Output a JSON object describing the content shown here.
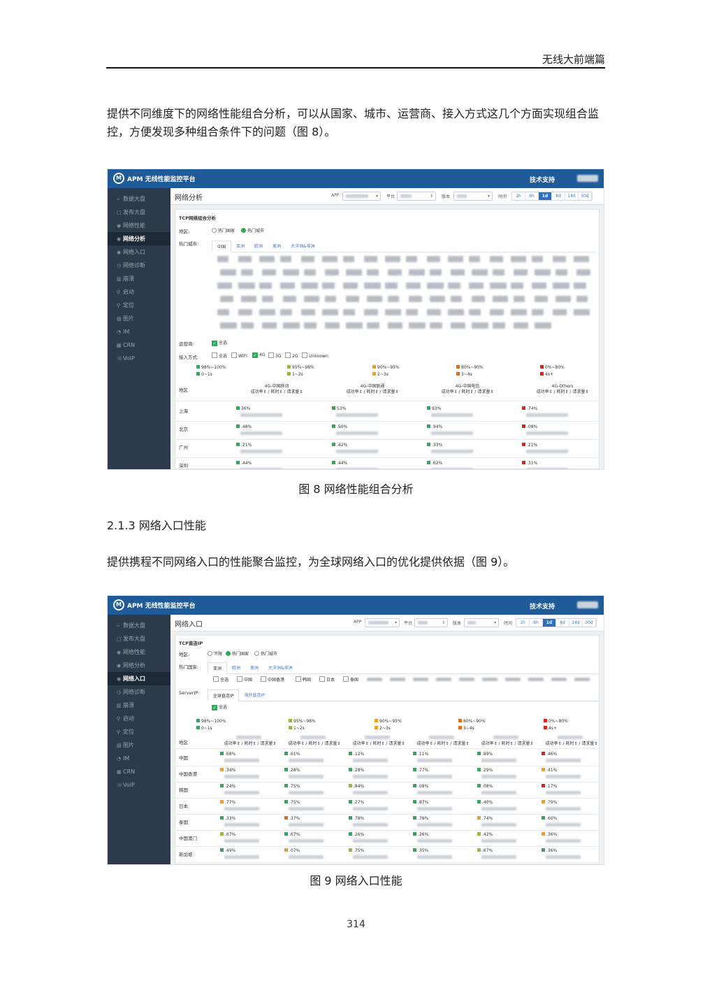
{
  "header": {
    "title": "无线大前端篇"
  },
  "paragraph1": "提供不同维度下的网络性能组合分析，可以从国家、城市、运营商、接入方式这几个方面实现组合监控，方便发现多种组合条件下的问题（图 8）。",
  "figure8_caption": "图 8 网络性能组合分析",
  "section_heading": "2.1.3 网络入口性能",
  "paragraph2": "提供携程不同网络入口的性能聚合监控，为全球网络入口的优化提供依据（图 9）。",
  "figure9_caption": "图 9 网络入口性能",
  "page_number": "314",
  "app": {
    "brand": "APM 无线性能监控平台",
    "support": "技术支持",
    "logo": "M",
    "toolbar": {
      "app_label": "APP",
      "platform_label": "平台",
      "version_label": "版本",
      "time_label": "时间",
      "ranges": [
        "1h",
        "6h",
        "1d",
        "8d",
        "14d",
        "30d"
      ],
      "active_range": "1d"
    },
    "sidebar": [
      {
        "icon": "chart-line-icon",
        "label": "数据大盘"
      },
      {
        "icon": "square-icon",
        "label": "发布大盘"
      },
      {
        "icon": "wifi-icon",
        "label": "网络性能"
      },
      {
        "icon": "wifi-icon",
        "label": "网络分析"
      },
      {
        "icon": "wifi-icon",
        "label": "网络入口"
      },
      {
        "icon": "clock-icon",
        "label": "网络诊断"
      },
      {
        "icon": "bars-icon",
        "label": "崩溃"
      },
      {
        "icon": "pin-icon",
        "label": "启动"
      },
      {
        "icon": "pin-icon",
        "label": "定位"
      },
      {
        "icon": "image-icon",
        "label": "图片"
      },
      {
        "icon": "chat-icon",
        "label": "IM"
      },
      {
        "icon": "grid-icon",
        "label": "CRN"
      },
      {
        "icon": "phone-icon",
        "label": "VoIP"
      }
    ],
    "colors": {
      "topbar": "#1f5b98",
      "sidebar": "#2c3a4b",
      "green": "#31a85a",
      "olive": "#a3b52c",
      "orange": "#e8a12a",
      "darkorange": "#e0701f",
      "red": "#d9261c"
    }
  },
  "fig8": {
    "active_menu": "网络分析",
    "page_title": "网络分析",
    "panel_title": "TCP网络组合分析",
    "region_label": "地区:",
    "region_options": [
      "热门国家",
      "热门城市"
    ],
    "hot_city_label": "热门城市:",
    "city_tabs": [
      "中国",
      "亚洲",
      "欧洲",
      "美洲",
      "大洋洲&非洲"
    ],
    "carrier_label": "运营商:",
    "carrier_all": "全选",
    "access_label": "接入方式:",
    "access_options": [
      "全选",
      "WIFI",
      "4G",
      "3G",
      "2G",
      "Unknown"
    ],
    "legend_top": [
      "98%~100%",
      "95%~98%",
      "90%~95%",
      "80%~90%",
      "0%~80%"
    ],
    "legend_bottom": [
      "0~1s",
      "1~2s",
      "2~3s",
      "3~4s",
      "4s+"
    ],
    "col_region": "地区",
    "col_sub": "成功率⇕ / 耗时⇕ / 请求量⇕",
    "columns": [
      "4G-中国移动",
      "4G-中国联通",
      "4G-中国电信",
      "4G-Others"
    ],
    "rows": [
      {
        "name": "上海",
        "cells": [
          "36%",
          "53%",
          "93%",
          ".74%"
        ]
      },
      {
        "name": "北京",
        "cells": ".48%",
        "cells_list": [
          ".48%",
          ".50%",
          ".94%",
          ".08%"
        ]
      },
      {
        "name": "广州",
        "cells_list": [
          ".21%",
          ".42%",
          ".33%",
          ".21%"
        ]
      },
      {
        "name": "深圳",
        "cells_list": [
          ".44%",
          ".44%",
          ".62%",
          ".31%"
        ]
      }
    ]
  },
  "fig9": {
    "active_menu": "网络入口",
    "page_title": "网络入口",
    "panel_title": "TCP直连IP",
    "region_label": "地区:",
    "region_options": [
      "不限",
      "热门国家",
      "热门城市"
    ],
    "hot_country_label": "热门国家:",
    "country_tabs": [
      "亚洲",
      "欧洲",
      "美洲",
      "大洋洲&非洲"
    ],
    "country_checks": [
      "全选",
      "中国",
      "中国香港",
      "韩国",
      "日本",
      "泰国"
    ],
    "server_label": "ServerIP:",
    "server_tabs": [
      "全球直连IP",
      "海外直连IP"
    ],
    "server_all": "全选",
    "legend_top": [
      "98%~100%",
      "95%~98%",
      "90%~95%",
      "80%~90%",
      "0%~80%"
    ],
    "legend_bottom": [
      "0~1s",
      "1~2s",
      "2~3s",
      "3~4s",
      "4s+"
    ],
    "col_region": "地区",
    "col_sub": "成功率⇕ / 耗时⇕ / 请求量⇕",
    "rows": [
      "中国",
      "中国香港",
      "韩国",
      "日本",
      "泰国",
      "中国澳门",
      "新加坡"
    ],
    "cells": [
      [
        ".68%",
        ".61%",
        ".12%",
        ".11%",
        ".89%",
        ".46%"
      ],
      [
        ".34%",
        ".28%",
        ".28%",
        ".77%",
        ".29%",
        ".41%"
      ],
      [
        ".24%",
        ".75%",
        ".84%",
        ".08%",
        ".08%",
        ".17%"
      ],
      [
        ".77%",
        ".75%",
        ".27%",
        ".87%",
        ".40%",
        ".79%"
      ],
      [
        ".33%",
        ".37%",
        ".78%",
        ".76%",
        ".74%",
        ".60%"
      ],
      [
        ".67%",
        ".67%",
        ".26%",
        ".26%",
        ".42%",
        ".36%"
      ],
      [
        ".49%",
        ".07%",
        ".75%",
        ".35%",
        ".67%",
        ".36%"
      ]
    ],
    "cell_colors": [
      [
        "green",
        "green",
        "green",
        "green",
        "green",
        "red"
      ],
      [
        "orange",
        "green",
        "green",
        "green",
        "green",
        "orange"
      ],
      [
        "green",
        "green",
        "olive",
        "green",
        "green",
        "red"
      ],
      [
        "orange",
        "green",
        "green",
        "green",
        "green",
        "orange"
      ],
      [
        "green",
        "darkorange",
        "green",
        "green",
        "orange",
        "green"
      ],
      [
        "olive",
        "green",
        "green",
        "green",
        "olive",
        "orange"
      ],
      [
        "green",
        "orange",
        "olive",
        "green",
        "olive",
        "green"
      ]
    ]
  }
}
